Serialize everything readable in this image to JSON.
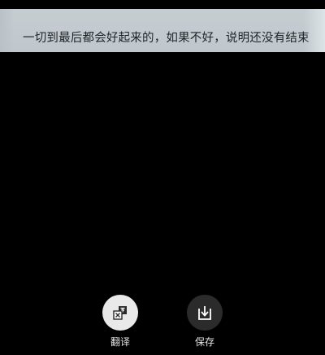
{
  "photo": {
    "text": "一切到最后都会好起来的，如果不好，说明还没有结束"
  },
  "actions": {
    "translate": {
      "label": "翻译",
      "icon": "translate-icon"
    },
    "save": {
      "label": "保存",
      "icon": "download-icon"
    }
  },
  "colors": {
    "background": "#000000",
    "translate_button": "#e9e9e9",
    "save_button": "#2b2b2b",
    "label_text": "#e4e4e4"
  }
}
